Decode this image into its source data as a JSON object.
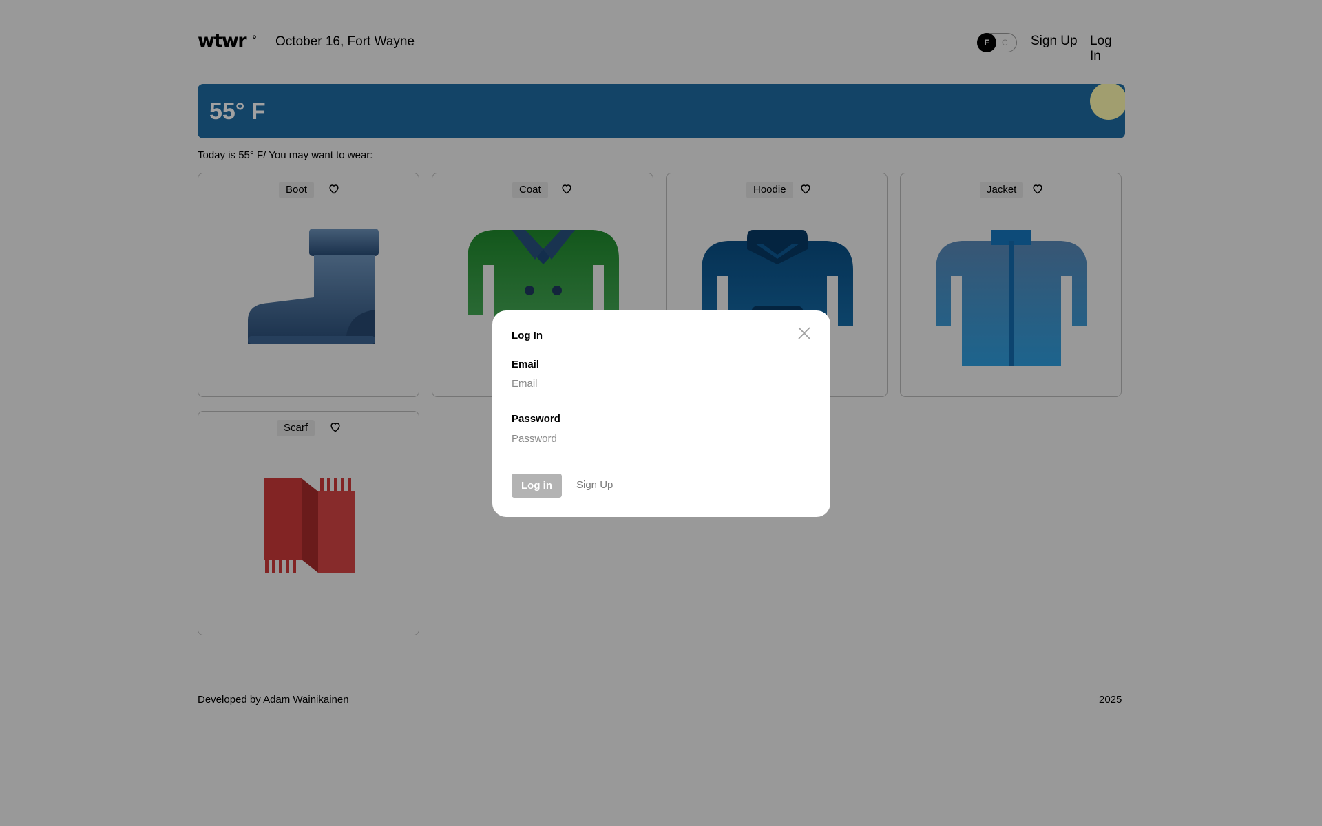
{
  "header": {
    "logo": "wtwr",
    "logo_degree": "°",
    "date_location": "October 16, Fort Wayne",
    "toggle_f": "F",
    "toggle_c": "C",
    "signup": "Sign Up",
    "login": "Log In"
  },
  "weather": {
    "temperature": "55° F",
    "suggestion": "Today is 55° F/ You may want to wear:"
  },
  "items": [
    {
      "name": "Boot",
      "icon": "boot-icon"
    },
    {
      "name": "Coat",
      "icon": "coat-icon"
    },
    {
      "name": "Hoodie",
      "icon": "hoodie-icon"
    },
    {
      "name": "Jacket",
      "icon": "jacket-icon"
    },
    {
      "name": "Scarf",
      "icon": "scarf-icon"
    }
  ],
  "footer": {
    "developer": "Developed by Adam Wainikainen",
    "year": "2025"
  },
  "modal": {
    "title": "Log In",
    "email_label": "Email",
    "email_placeholder": "Email",
    "password_label": "Password",
    "password_placeholder": "Password",
    "submit": "Log in",
    "alt_action": "Sign Up"
  },
  "colors": {
    "weather_banner": "#1f6ca3",
    "sun": "#fffbb0",
    "overlay": "rgba(0,0,0,0.37)",
    "submit_disabled": "#b3b3b3"
  }
}
